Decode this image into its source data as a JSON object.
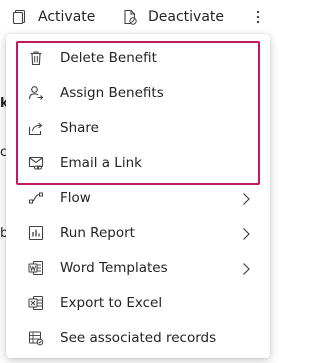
{
  "toolbar": {
    "activate_label": "Activate",
    "deactivate_label": "Deactivate",
    "activate_icon": "activate-icon",
    "deactivate_icon": "deactivate-icon",
    "more_icon": "more-vertical-icon"
  },
  "background": {
    "fragments": [
      "k",
      "ci",
      "b"
    ]
  },
  "menu": {
    "highlight_color": "#c4185c",
    "items": [
      {
        "label": "Delete Benefit",
        "icon": "trash-icon",
        "submenu": false
      },
      {
        "label": "Assign Benefits",
        "icon": "assign-user-icon",
        "submenu": false
      },
      {
        "label": "Share",
        "icon": "share-icon",
        "submenu": false
      },
      {
        "label": "Email a Link",
        "icon": "email-link-icon",
        "submenu": false
      },
      {
        "label": "Flow",
        "icon": "flow-icon",
        "submenu": true
      },
      {
        "label": "Run Report",
        "icon": "report-icon",
        "submenu": true
      },
      {
        "label": "Word Templates",
        "icon": "word-icon",
        "submenu": true
      },
      {
        "label": "Export to Excel",
        "icon": "excel-icon",
        "submenu": false
      },
      {
        "label": "See associated records",
        "icon": "associated-records-icon",
        "submenu": false
      }
    ]
  }
}
